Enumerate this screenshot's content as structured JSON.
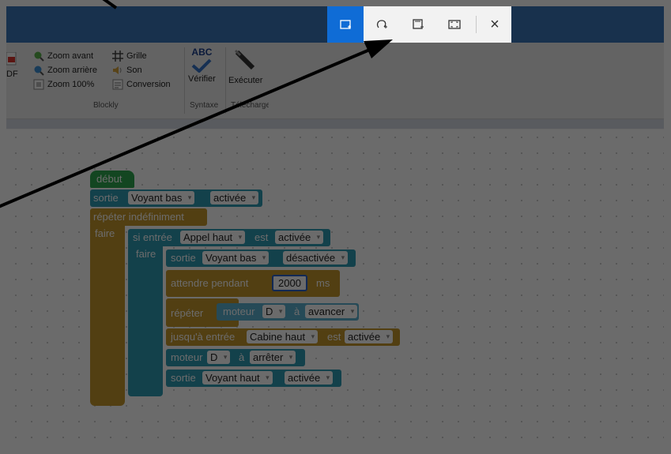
{
  "ribbon": {
    "zoom_in": "Zoom avant",
    "zoom_out": "Zoom arrière",
    "zoom_100": "Zoom 100%",
    "grid": "Grille",
    "sound": "Son",
    "conversion": "Conversion",
    "check": "Vérifier",
    "run": "Exécuter",
    "pdf_fragment": "DF",
    "spell_icon_text": "ABC",
    "groups": {
      "blockly": "Blockly",
      "syntax": "Syntaxe",
      "transfer": "Télécharger"
    }
  },
  "blocks": {
    "start": "début",
    "out1": {
      "kw": "sortie",
      "target": "Voyant bas",
      "state": "activée"
    },
    "repeat_forever": "répéter indéfiniment",
    "do": "faire",
    "if": {
      "kw": "si entrée",
      "input": "Appel haut",
      "is": "est",
      "state": "activée"
    },
    "if_do": "faire",
    "out2": {
      "kw": "sortie",
      "target": "Voyant bas",
      "state": "désactivée"
    },
    "wait": {
      "kw": "attendre pendant",
      "value": "2000",
      "unit": "ms"
    },
    "repeat": "répéter",
    "motor1": {
      "kw": "moteur",
      "id": "D",
      "at": "à",
      "action": "avancer"
    },
    "until": {
      "kw": "jusqu'à entrée",
      "input": "Cabine haut",
      "is": "est",
      "state": "activée"
    },
    "motor2": {
      "kw": "moteur",
      "id": "D",
      "at": "à",
      "action": "arrêter"
    },
    "out3": {
      "kw": "sortie",
      "target": "Voyant haut",
      "state": "activée"
    }
  },
  "snip_toolbar": {
    "modes": [
      "rectangle-snip",
      "freeform-snip",
      "window-snip",
      "fullscreen-snip"
    ],
    "active_mode": "rectangle-snip",
    "close": "×"
  },
  "colors": {
    "accent": "#0f6cd6",
    "loop": "#c4962c",
    "io": "#2f9bb4",
    "start": "#2fa84f",
    "motor": "#5bb0cf"
  }
}
